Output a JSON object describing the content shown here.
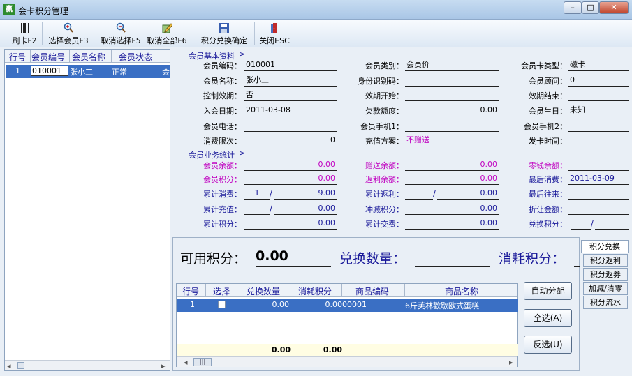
{
  "window": {
    "title": "会卡积分管理",
    "icon_text": "赢",
    "min": "–",
    "max": "□",
    "close": "✕"
  },
  "toolbar": [
    {
      "label": "刷卡F2",
      "icon": "barcode-icon"
    },
    {
      "label": "选择会员F3",
      "icon": "zoom-in-icon"
    },
    {
      "label": "取消选择F5",
      "icon": "zoom-out-icon"
    },
    {
      "label": "取消全部F6",
      "icon": "edit-icon"
    },
    {
      "label": "积分兑换确定",
      "icon": "save-icon"
    },
    {
      "label": "关闭ESC",
      "icon": "door-exit-icon"
    }
  ],
  "left_list": {
    "headers": [
      "行号",
      "会员编号",
      "会员名称",
      "会员状态"
    ],
    "row": {
      "no": "1",
      "id": "010001",
      "name": "张小工",
      "status": "正常",
      "extra": "会"
    }
  },
  "basic": {
    "section_title": "会员基本资料",
    "card_no_label": "会员编码：",
    "card_no": "010001",
    "type_label": "会员类别：",
    "type": "会员价",
    "card_type_label": "会员卡类型：",
    "card_type": "磁卡",
    "name_label": "会员名称：",
    "name": "张小工",
    "idcard_label": "身份识别码：",
    "idcard": "",
    "adviser_label": "会员顾问：",
    "adviser": "0",
    "validity_label": "控制效期：",
    "validity": "否",
    "valid_start_label": "效期开始：",
    "valid_start": "",
    "valid_end_label": "效期结束：",
    "valid_end": "",
    "join_label": "入会日期：",
    "join": "2011-03-08",
    "debt_label": "欠款额度：",
    "debt": "0.00",
    "birthday_label": "会员生日：",
    "birthday": "未知",
    "phone_label": "会员电话：",
    "phone": "",
    "mobile1_label": "会员手机1：",
    "mobile1": "",
    "mobile2_label": "会员手机2：",
    "mobile2": "",
    "limit_label": "消费限次：",
    "limit": "0",
    "plan_label": "充值方案：",
    "plan": "不赠送",
    "issue_label": "发卡时间：",
    "issue": ""
  },
  "stats": {
    "section_title": "会员业务统计",
    "balance_label": "会员余额：",
    "balance": "0.00",
    "gift_label": "赠送余额：",
    "gift": "0.00",
    "change_label": "零钱余额：",
    "change": "",
    "points_label": "会员积分：",
    "points": "0.00",
    "rebate_bal_label": "返利余额：",
    "rebate_bal": "0.00",
    "last_spend_label": "最后消费：",
    "last_spend": "2011-03-09",
    "cum_spend_label": "累计消费：",
    "cum_spend_count": "1",
    "cum_spend": "9.00",
    "cum_rebate_label": "累计返利：",
    "cum_rebate": "0.00",
    "last_contact_label": "最后往来：",
    "last_contact": "",
    "cum_recharge_label": "累计充值：",
    "cum_recharge": "0.00",
    "offset_label": "冲减积分：",
    "offset": "0.00",
    "discount_label": "折让金额：",
    "discount": "",
    "cum_points_label": "累计积分：",
    "cum_points": "0.00",
    "cum_trade_label": "累计交费：",
    "cum_trade": "0.00",
    "exchange_label": "兑换积分：",
    "exchange": ""
  },
  "exchange": {
    "avail_label": "可用积分：",
    "avail": "0.00",
    "qty_label": "兑换数量：",
    "qty": "",
    "consume_label": "消耗积分：",
    "consume": "",
    "headers": [
      "行号",
      "选择",
      "兑换数量",
      "消耗积分",
      "商品编码",
      "商品名称"
    ],
    "row": {
      "no": "1",
      "qty": "0.00",
      "pts": "0.00",
      "code": "00001",
      "name": "6斤芙林歡歇欧式蛋糕"
    },
    "total_qty": "0.00",
    "total_pts": "0.00",
    "btn_auto": "自动分配",
    "btn_all": "全选(A)",
    "btn_inv": "反选(U)"
  },
  "tabs": [
    "积分兑换",
    "积分返利",
    "积分返券",
    "加減/清零",
    "积分流水"
  ],
  "scroll": {
    "left": "◂",
    "right": "▸",
    "grip": "|||"
  },
  "colors": {
    "accent": "#1a1a9a",
    "selected": "#3a6fc4",
    "magenta": "#c000c0"
  }
}
